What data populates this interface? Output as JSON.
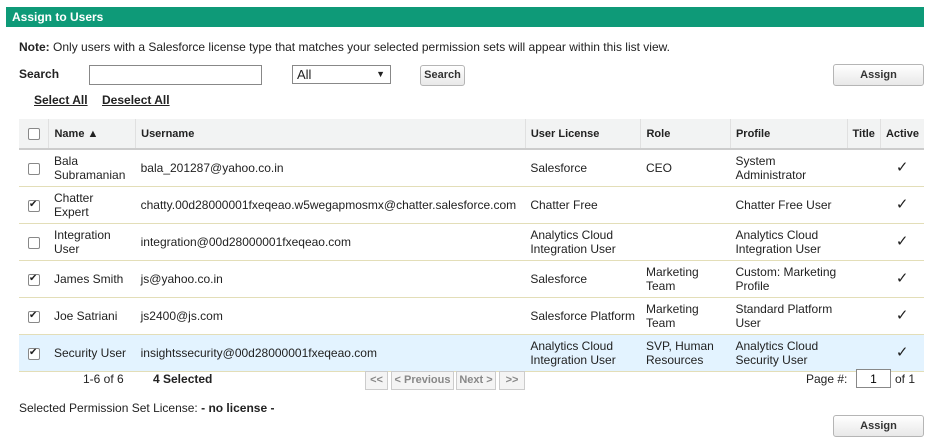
{
  "header": {
    "title": "Assign to Users"
  },
  "note": {
    "label": "Note:",
    "text": "Only users with a Salesforce license type that matches your selected permission sets will appear within this list view."
  },
  "search": {
    "label": "Search",
    "value": "",
    "filter_selected": "All",
    "button": "Search"
  },
  "assign_button": "Assign",
  "select_all": "Select All",
  "deselect_all": "Deselect All",
  "table": {
    "columns": [
      "Name ▲",
      "Username",
      "User License",
      "Role",
      "Profile",
      "Title",
      "Active"
    ],
    "rows": [
      {
        "checked": false,
        "name": "Bala Subramanian",
        "username": "bala_201287@yahoo.co.in",
        "license": "Salesforce",
        "role": "CEO",
        "profile": "System Administrator",
        "title": "",
        "active": "✓"
      },
      {
        "checked": true,
        "name": "Chatter Expert",
        "username": "chatty.00d28000001fxeqeao.w5wegapmosmx@chatter.salesforce.com",
        "license": "Chatter Free",
        "role": "",
        "profile": "Chatter Free User",
        "title": "",
        "active": "✓"
      },
      {
        "checked": false,
        "name": "Integration User",
        "username": "integration@00d28000001fxeqeao.com",
        "license": "Analytics Cloud Integration User",
        "role": "",
        "profile": "Analytics Cloud Integration User",
        "title": "",
        "active": "✓"
      },
      {
        "checked": true,
        "name": "James Smith",
        "username": "js@yahoo.co.in",
        "license": "Salesforce",
        "role": "Marketing Team",
        "profile": "Custom: Marketing Profile",
        "title": "",
        "active": "✓"
      },
      {
        "checked": true,
        "name": "Joe Satriani",
        "username": "js2400@js.com",
        "license": "Salesforce Platform",
        "role": "Marketing Team",
        "profile": "Standard Platform User",
        "title": "",
        "active": "✓"
      },
      {
        "checked": true,
        "name": "Security User",
        "username": "insightssecurity@00d28000001fxeqeao.com",
        "license": "Analytics Cloud Integration User",
        "role": "SVP, Human Resources",
        "profile": "Analytics Cloud Security User",
        "title": "",
        "active": "✓"
      }
    ]
  },
  "pagination": {
    "range": "1-6 of 6",
    "selected": "4 Selected",
    "first": "<<",
    "prev": "< Previous",
    "next": "Next >",
    "last": ">>",
    "page_label": "Page #:",
    "page_value": "1",
    "page_of": "of 1"
  },
  "license": {
    "label": "Selected Permission Set License:",
    "value": "- no license -"
  }
}
